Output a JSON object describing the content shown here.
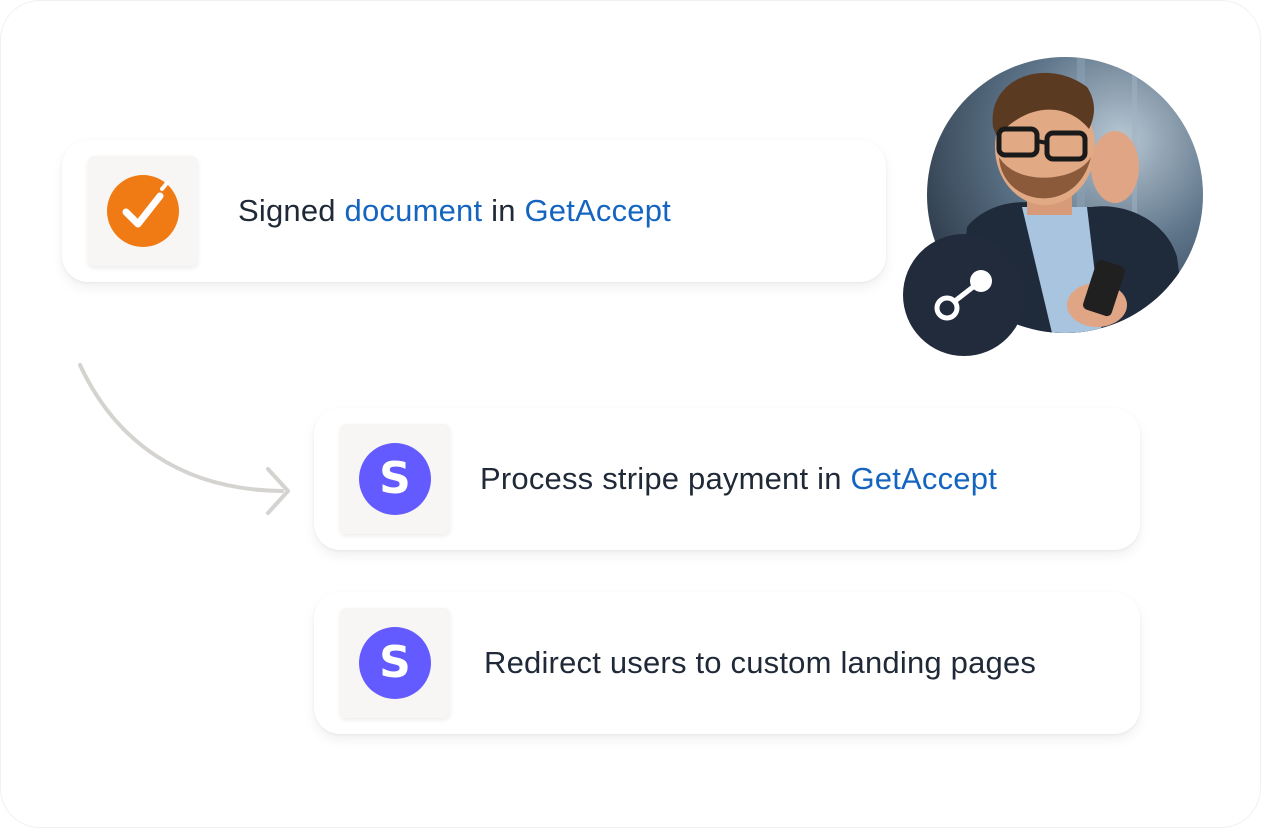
{
  "steps": [
    {
      "icon": "orange-check-icon",
      "text_before": "Signed ",
      "highlight_1": "document",
      "text_middle": " in ",
      "highlight_2": "GetAccept"
    },
    {
      "icon": "stripe-icon",
      "text_before": "Process stripe payment in ",
      "highlight": "GetAccept"
    },
    {
      "icon": "stripe-icon",
      "text": "Redirect users to custom landing pages"
    }
  ],
  "stripe_letter": "S",
  "avatar": {
    "description": "man-with-glasses-holding-phone"
  },
  "badge_icon": "connector-icon",
  "colors": {
    "text": "#1f2937",
    "accent": "#1565c0",
    "orange": "#f07b14",
    "stripe": "#635bff",
    "badge": "#212b3c"
  }
}
